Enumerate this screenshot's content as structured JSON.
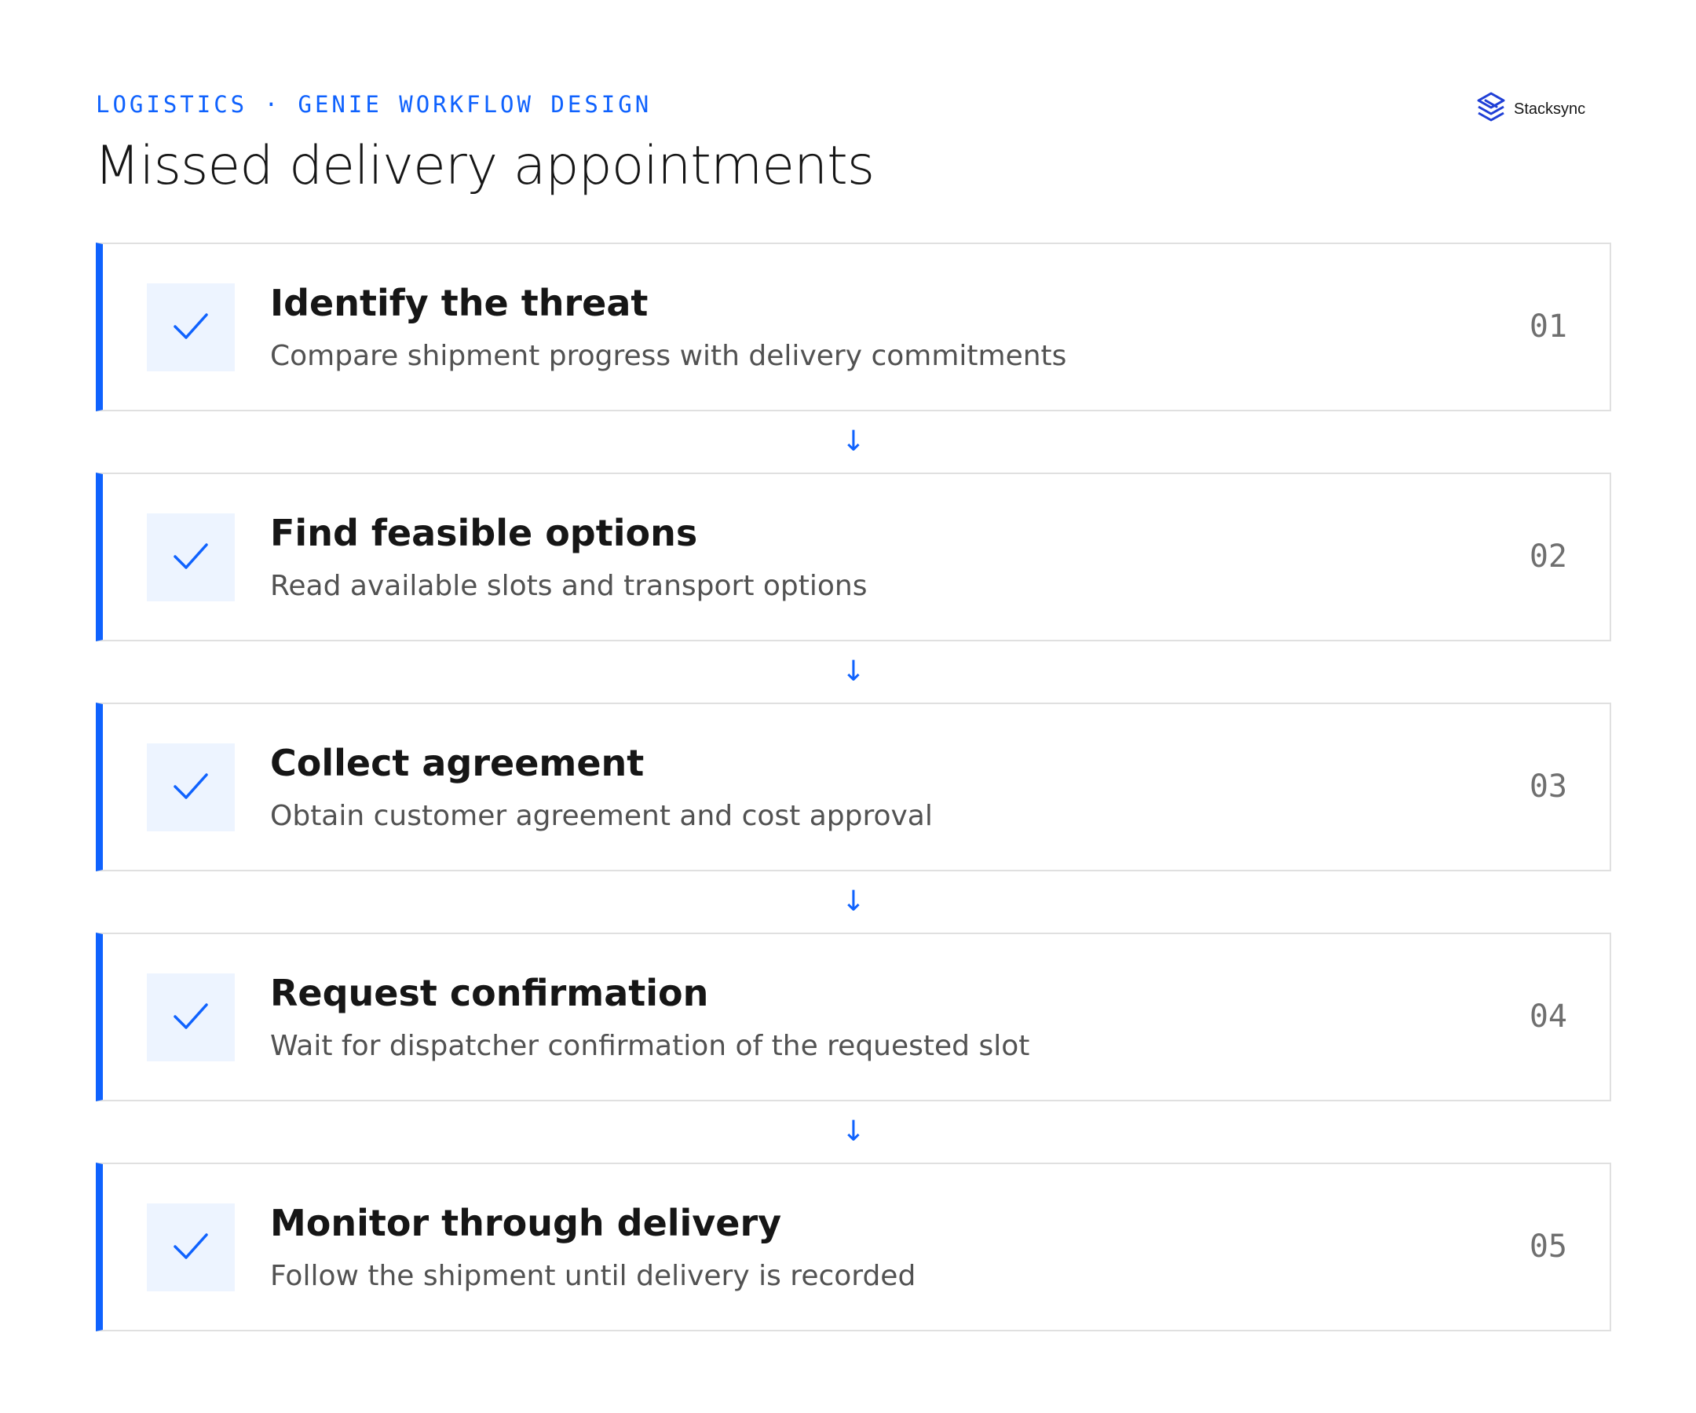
{
  "header": {
    "eyebrow": "LOGISTICS · GENIE WORKFLOW DESIGN",
    "title": "Missed delivery appointments"
  },
  "brand": {
    "name": "Stacksync",
    "logo_icon": "stacksync-logo-icon"
  },
  "colors": {
    "accent": "#0f62fe",
    "check_bg": "#edf4ff",
    "border": "#e0e0e0",
    "title_text": "#161616",
    "desc_text": "#525252",
    "number_text": "#6f6f6f"
  },
  "connector_arrow": "↓",
  "steps": [
    {
      "title": "Identify the threat",
      "description": "Compare shipment progress with delivery commitments",
      "number": "01",
      "icon": "check-icon"
    },
    {
      "title": "Find feasible options",
      "description": "Read available slots and transport options",
      "number": "02",
      "icon": "check-icon"
    },
    {
      "title": "Collect agreement",
      "description": "Obtain customer agreement and cost approval",
      "number": "03",
      "icon": "check-icon"
    },
    {
      "title": "Request confirmation",
      "description": "Wait for dispatcher confirmation of the requested slot",
      "number": "04",
      "icon": "check-icon"
    },
    {
      "title": "Monitor through delivery",
      "description": "Follow the shipment until delivery is recorded",
      "number": "05",
      "icon": "check-icon"
    }
  ]
}
